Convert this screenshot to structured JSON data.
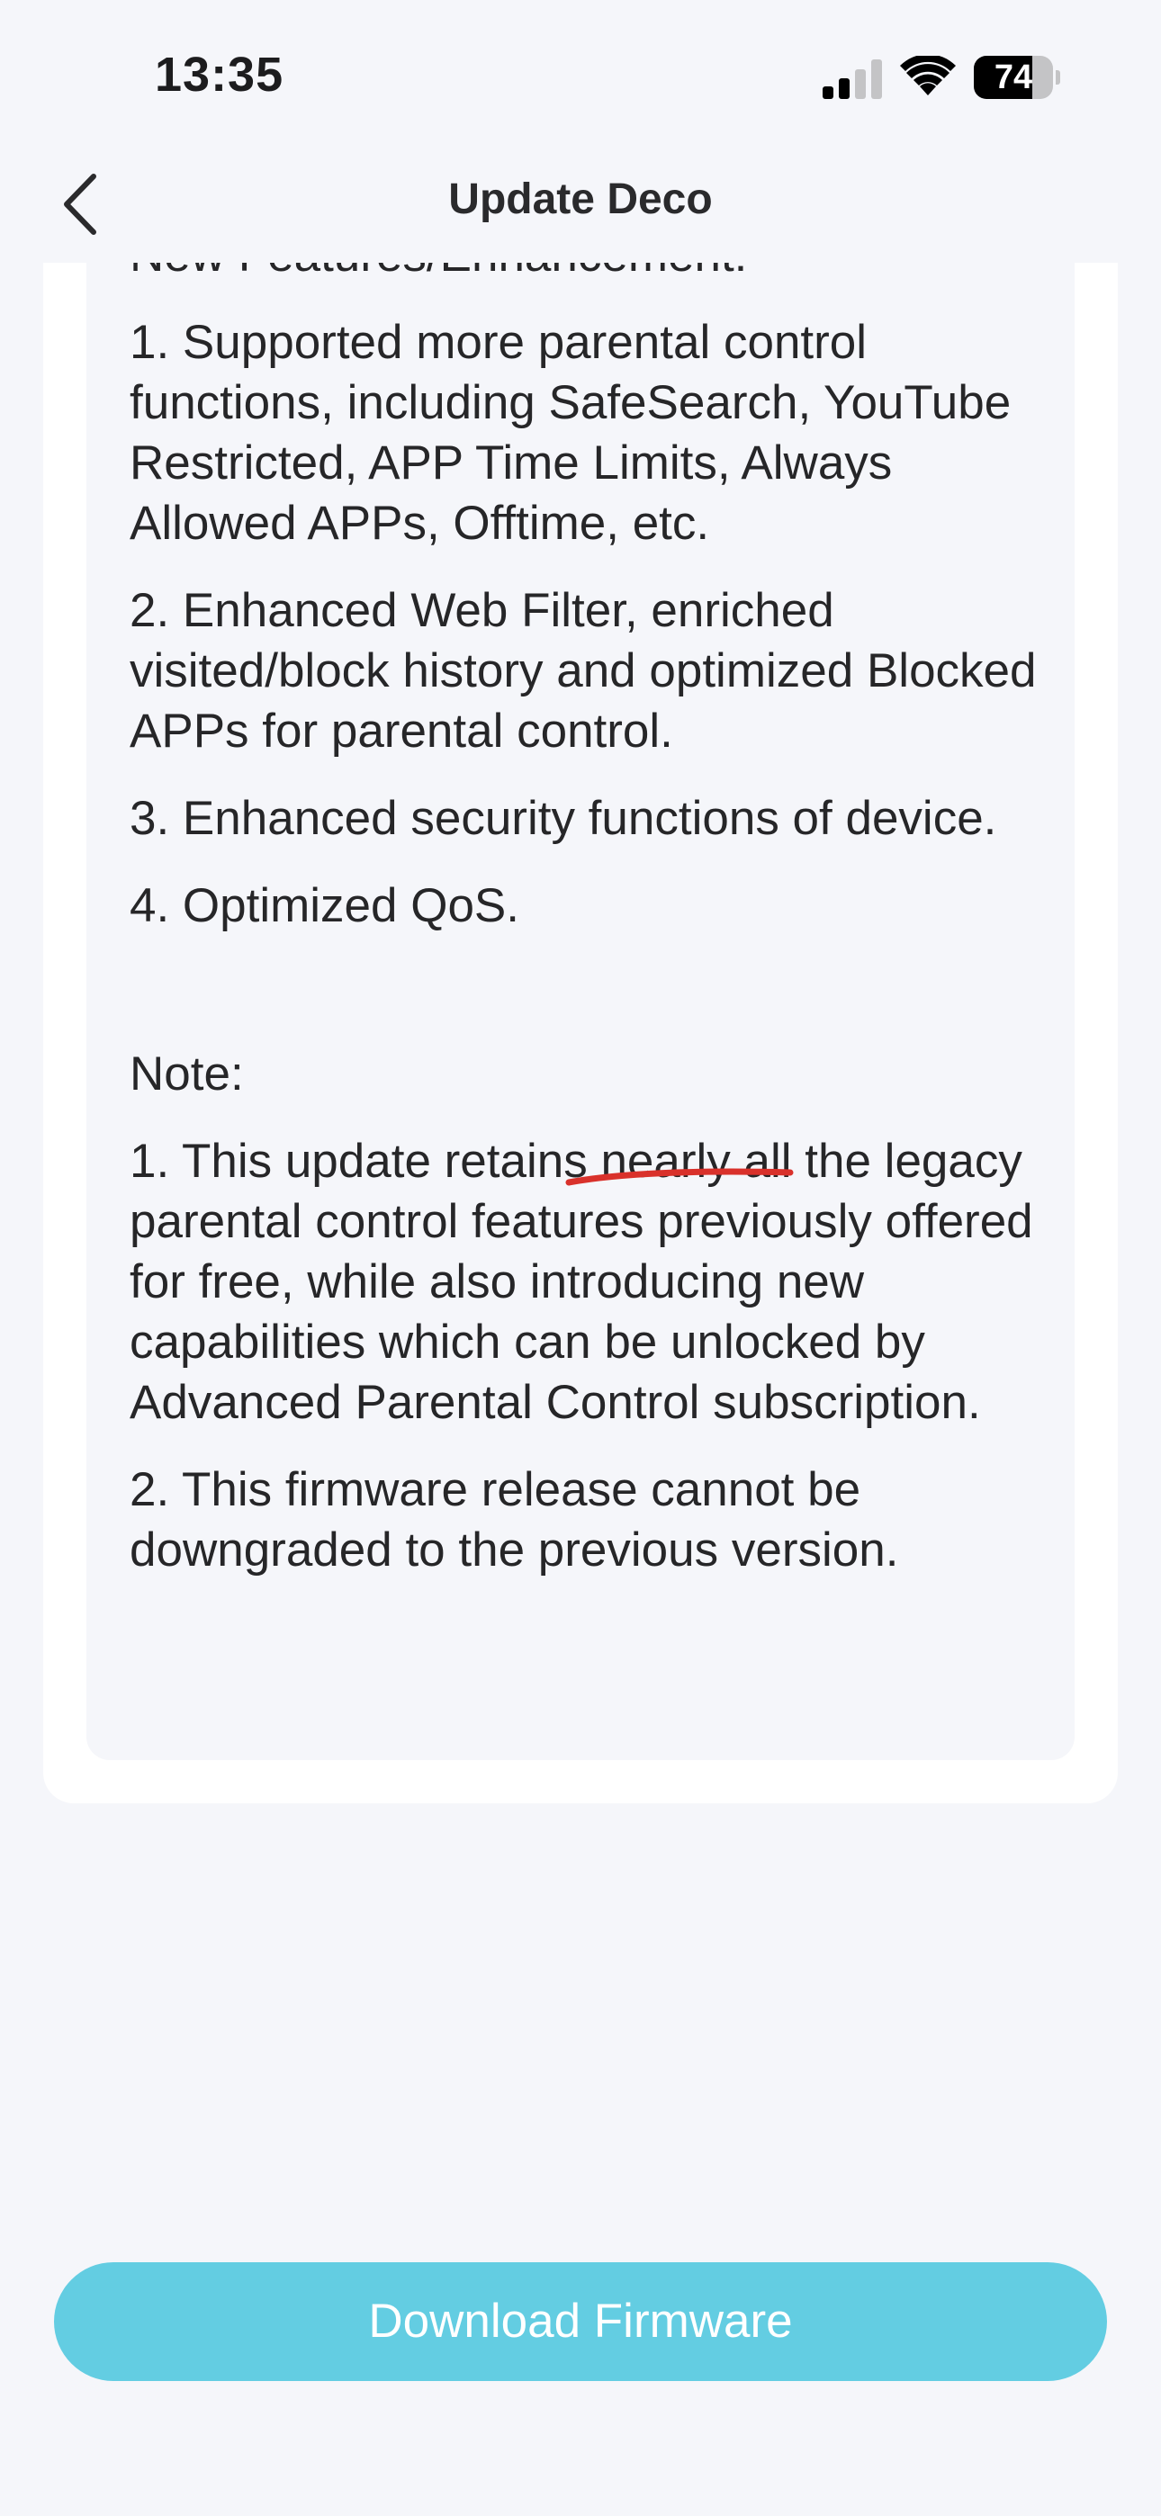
{
  "status_bar": {
    "time": "13:35",
    "battery_level": "74",
    "battery_fraction": 0.74,
    "signal_icon": "cellular-signal-icon",
    "wifi_icon": "wifi-icon"
  },
  "nav": {
    "back_icon": "chevron-left-icon",
    "title": "Update Deco"
  },
  "release_notes": {
    "features_heading": "New Features/Enhancement:",
    "features": [
      "1. Supported more parental control functions, including SafeSearch, YouTube Restricted, APP Time Limits, Always Allowed APPs, Offtime, etc.",
      "2. Enhanced Web Filter, enriched visited/block history and optimized Blocked APPs for parental control.",
      "3. Enhanced security functions of device.",
      "4. Optimized QoS."
    ],
    "note_heading": "Note:",
    "notes": [
      "1. This update retains nearly all the legacy parental control features previously offered for free, while also introducing new capabilities which can be unlocked by Advanced Parental Control subscription.",
      "2. This firmware release cannot be downgraded to the previous version."
    ]
  },
  "annotation": {
    "underline_color": "#d9312b"
  },
  "actions": {
    "download_label": "Download Firmware",
    "download_color": "#63cde2"
  }
}
